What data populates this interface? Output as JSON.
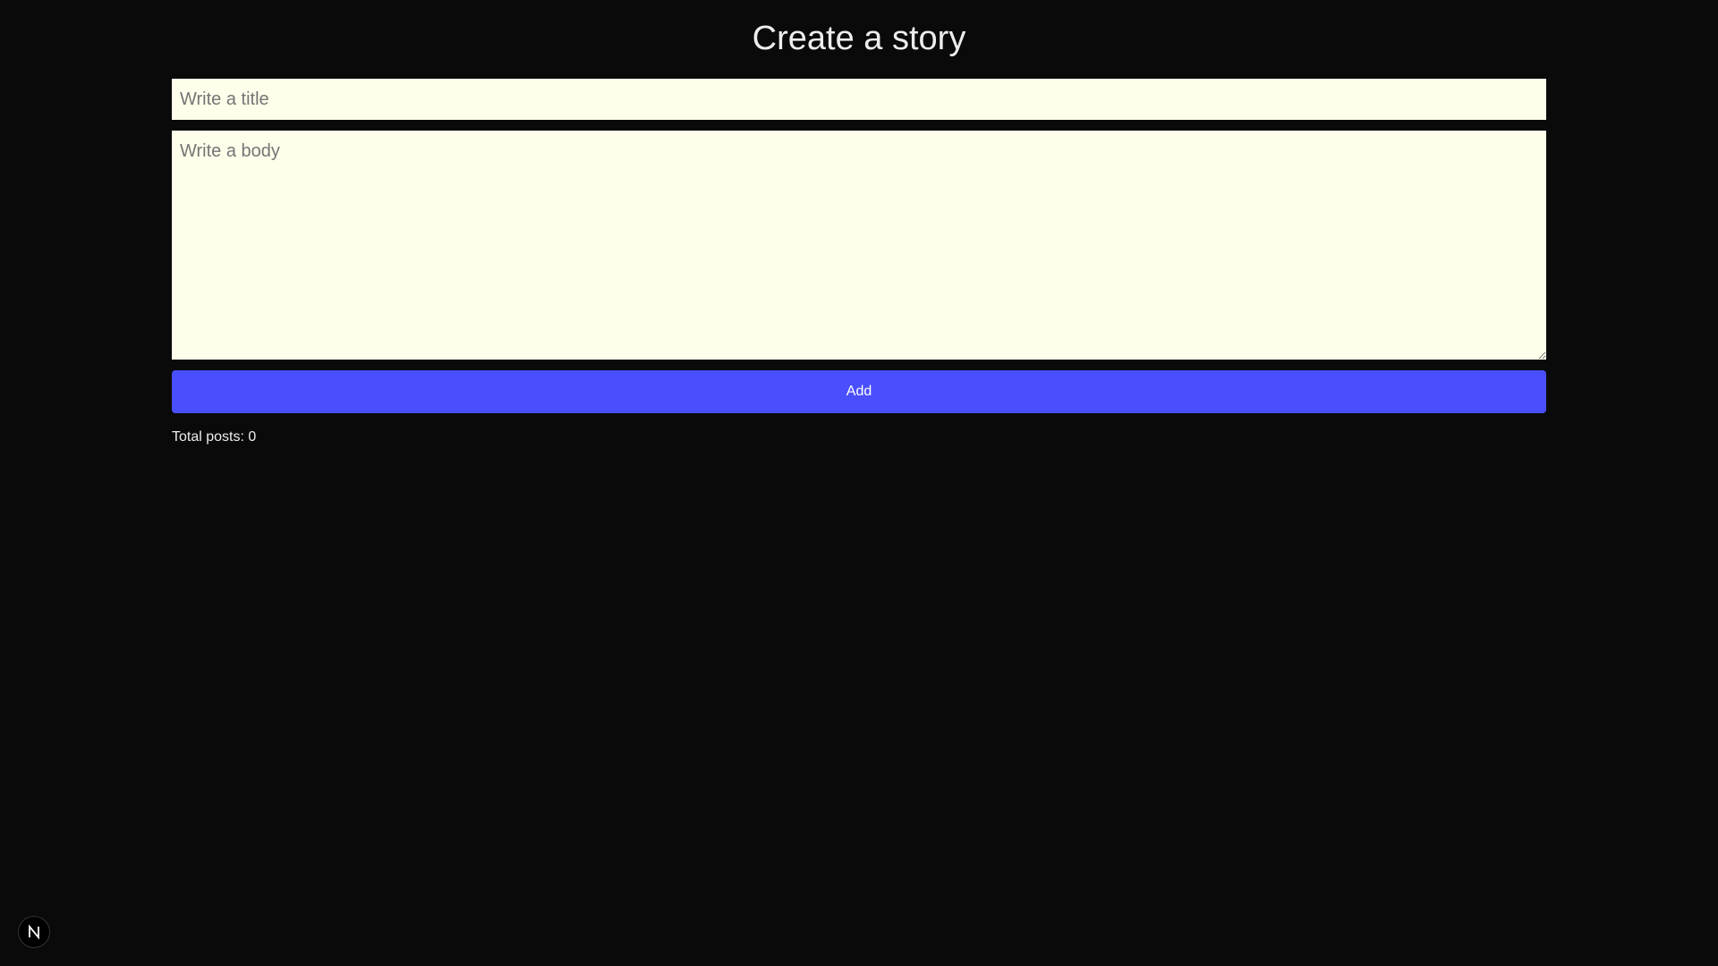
{
  "header": {
    "title": "Create a story"
  },
  "form": {
    "title_placeholder": "Write a title",
    "title_value": "",
    "body_placeholder": "Write a body",
    "body_value": "",
    "add_label": "Add"
  },
  "status": {
    "total_posts": "Total posts: 0"
  },
  "colors": {
    "background": "#0a0a0a",
    "input_background": "#fffeea",
    "button_accent": "#4a4ffd"
  },
  "dev_badge": {
    "icon": "nextjs-logo-icon"
  }
}
